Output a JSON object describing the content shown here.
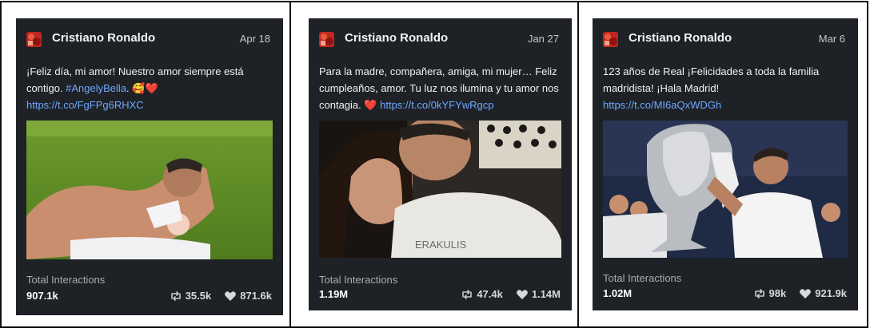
{
  "cards": [
    {
      "author": "Cristiano Ronaldo",
      "date": "Apr 18",
      "text_plain": "¡Feliz día, mi amor! Nuestro amor siempre está contigo. ",
      "hashtag": "#AngelyBella",
      "text_after": ". 🥰❤️",
      "link": "https://t.co/FgFPg6RHXC",
      "interactions_label": "Total Interactions",
      "interactions_total": "907.1k",
      "retweets": "35.5k",
      "likes": "871.6k"
    },
    {
      "author": "Cristiano Ronaldo",
      "date": "Jan 27",
      "text_plain": "Para la madre, compañera, amiga, mi mujer… Feliz cumpleaños, amor. Tu luz nos ilumina y tu amor nos contagia. ❤️ ",
      "link": "https://t.co/0kYFYwRgcp",
      "interactions_label": "Total Interactions",
      "interactions_total": "1.19M",
      "retweets": "47.4k",
      "likes": "1.14M"
    },
    {
      "author": "Cristiano Ronaldo",
      "date": "Mar 6",
      "text_plain": "123 años de Real ¡Felicidades a toda la familia madridista! ¡Hala Madrid!",
      "link": "https://t.co/MI6aQxWDGh",
      "interactions_label": "Total Interactions",
      "interactions_total": "1.02M",
      "retweets": "98k",
      "likes": "921.9k"
    }
  ],
  "icons": {
    "avatar": "avatar-image",
    "retweet": "retweet-icon",
    "like": "heart-icon"
  }
}
